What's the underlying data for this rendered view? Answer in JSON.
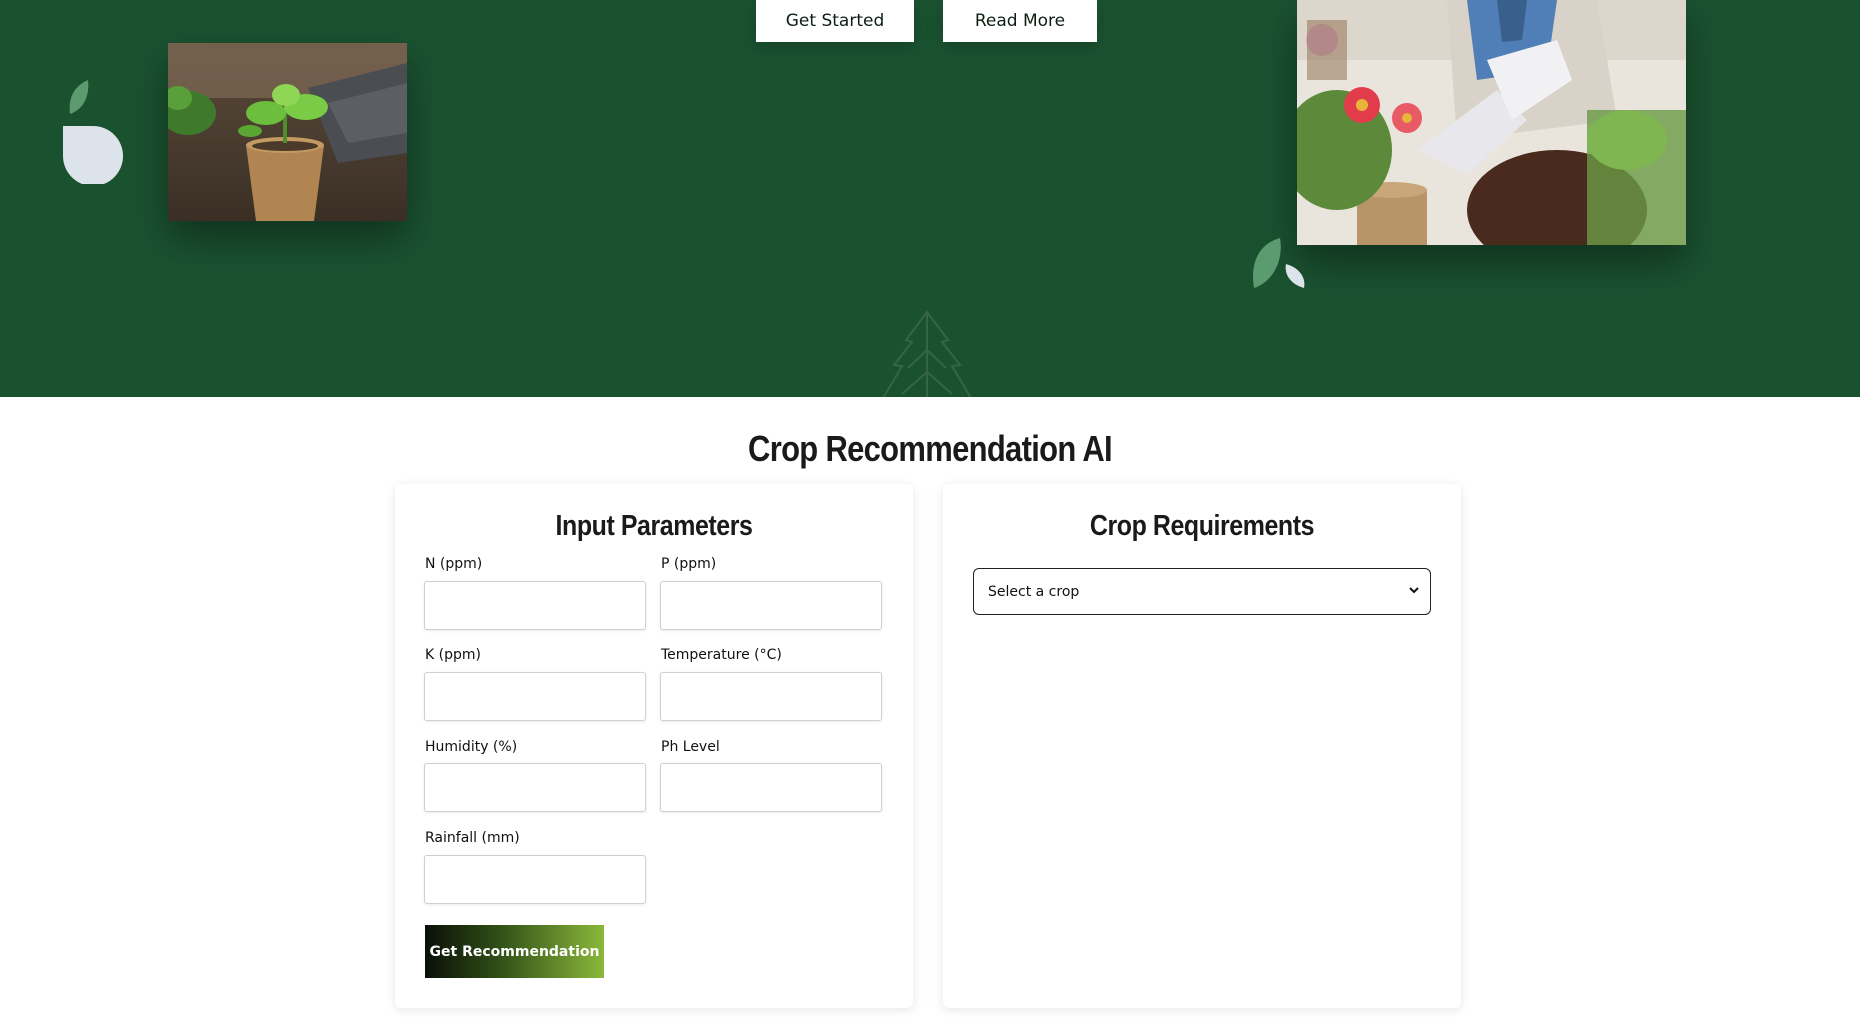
{
  "hero": {
    "get_started_label": "Get Started",
    "read_more_label": "Read More",
    "background_color": "#1a5230",
    "photos": [
      "seedling-in-peat-pot-photo",
      "gardener-with-flowers-photo"
    ]
  },
  "main": {
    "title": "Crop Recommendation AI",
    "inputs_card": {
      "title": "Input Parameters",
      "fields": [
        {
          "label": "N (ppm)",
          "value": ""
        },
        {
          "label": "P (ppm)",
          "value": ""
        },
        {
          "label": "K (ppm)",
          "value": ""
        },
        {
          "label": "Temperature (°C)",
          "value": ""
        },
        {
          "label": "Humidity (%)",
          "value": ""
        },
        {
          "label": "Ph Level",
          "value": ""
        },
        {
          "label": "Rainfall (mm)",
          "value": ""
        }
      ],
      "submit_label": "Get Recommendation"
    },
    "requirements_card": {
      "title": "Crop Requirements",
      "select_value": "Select a crop"
    }
  },
  "colors": {
    "hero_green": "#1a5230",
    "button_gradient_start": "#0a0f08",
    "button_gradient_end": "#8ab83a"
  }
}
